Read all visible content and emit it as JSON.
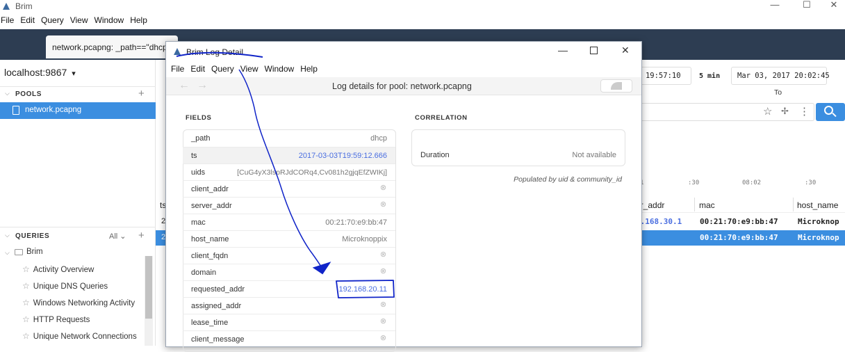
{
  "window": {
    "title": "Brim",
    "minimize": "—",
    "maximize": "☐",
    "close": "✕"
  },
  "menu": [
    "File",
    "Edit",
    "Query",
    "View",
    "Window",
    "Help"
  ],
  "tab": {
    "label": "network.pcapng: _path==\"dhcp"
  },
  "sidebar": {
    "host": "localhost:9867",
    "pools_header": "POOLS",
    "pools": [
      "network.pcapng"
    ],
    "queries_header": "QUERIES",
    "queries_filter": "All",
    "group": "Brim",
    "queries": [
      "Activity Overview",
      "Unique DNS Queries",
      "Windows Networking Activity",
      "HTTP Requests",
      "Unique Network Connections"
    ]
  },
  "search": {
    "from": "17  19:57:10",
    "duration": "5 min",
    "to": "Mar 03, 2017  20:02:45",
    "to_label": "To",
    "timeline_ticks": [
      ":30",
      "08:02",
      ":30"
    ],
    "timeline_tick_left": "1"
  },
  "results": {
    "columns": [
      "ts",
      "er_addr",
      "mac",
      "host_name"
    ],
    "rows": [
      {
        "ts": "2",
        "addr": "2.168.30.1",
        "mac": "00:21:70:e9:bb:47",
        "host": "Microknop"
      },
      {
        "ts": "2",
        "addr": "",
        "mac": "00:21:70:e9:bb:47",
        "host": "Microknop"
      }
    ]
  },
  "detail": {
    "title": "Brim Log Detail",
    "menu": [
      "File",
      "Edit",
      "Query",
      "View",
      "Window",
      "Help"
    ],
    "header": "Log details for pool: network.pcapng",
    "fields_label": "FIELDS",
    "correlation_label": "CORRELATION",
    "fields": [
      {
        "key": "_path",
        "value": "dhcp",
        "kind": "text"
      },
      {
        "key": "ts",
        "value": "2017-03-03T19:59:12.666",
        "kind": "link"
      },
      {
        "key": "uids",
        "value": "[CuG4yX3lspRJdCORq4,Cv081h2gjqEfZWIKj]",
        "kind": "text"
      },
      {
        "key": "client_addr",
        "value": "⊗",
        "kind": "null"
      },
      {
        "key": "server_addr",
        "value": "⊗",
        "kind": "null"
      },
      {
        "key": "mac",
        "value": "00:21:70:e9:bb:47",
        "kind": "text"
      },
      {
        "key": "host_name",
        "value": "Microknoppix",
        "kind": "text"
      },
      {
        "key": "client_fqdn",
        "value": "⊗",
        "kind": "null"
      },
      {
        "key": "domain",
        "value": "⊗",
        "kind": "null"
      },
      {
        "key": "requested_addr",
        "value": "192.168.20.11",
        "kind": "link"
      },
      {
        "key": "assigned_addr",
        "value": "⊗",
        "kind": "null"
      },
      {
        "key": "lease_time",
        "value": "⊗",
        "kind": "null"
      },
      {
        "key": "client_message",
        "value": "⊗",
        "kind": "null"
      }
    ],
    "correlation": {
      "label": "Duration",
      "value": "Not available"
    },
    "populated_note": "Populated by uid & community_id"
  },
  "colors": {
    "accent": "#3b8ee0",
    "tabbar": "#2d3d52",
    "link": "#4a6ee0",
    "annotation": "#1024c8"
  }
}
